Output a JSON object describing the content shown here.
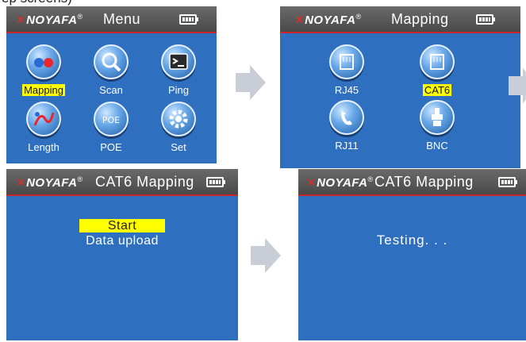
{
  "clipped_caption": "ep screens)",
  "brand": {
    "name": "NOYAFA",
    "registered": "®"
  },
  "screens": [
    {
      "title": "Menu",
      "items": [
        {
          "label": "Mapping",
          "icon": "mapping-icon",
          "selected": true
        },
        {
          "label": "Scan",
          "icon": "scan-icon",
          "selected": false
        },
        {
          "label": "Ping",
          "icon": "ping-icon",
          "selected": false
        },
        {
          "label": "Length",
          "icon": "length-icon",
          "selected": false
        },
        {
          "label": "POE",
          "icon": "poe-icon",
          "selected": false
        },
        {
          "label": "Set",
          "icon": "set-gear-icon",
          "selected": false
        }
      ]
    },
    {
      "title": "Mapping",
      "items": [
        {
          "label": "RJ45",
          "icon": "rj45-icon",
          "selected": false
        },
        {
          "label": "CAT6",
          "icon": "cat6-icon",
          "selected": true
        },
        {
          "label": "RJ11",
          "icon": "rj11-phone-icon",
          "selected": false
        },
        {
          "label": "BNC",
          "icon": "bnc-connector-icon",
          "selected": false
        }
      ]
    },
    {
      "title": "CAT6  Mapping",
      "options": [
        {
          "label": "Start",
          "selected": true
        },
        {
          "label": "Data upload",
          "selected": false
        }
      ]
    },
    {
      "title": "CAT6  Mapping",
      "status": "Testing. . ."
    }
  ],
  "colors": {
    "screen_bg": "#2f6fc0",
    "titlebar": "#5a5a5a",
    "title_rule": "#c8252b",
    "highlight": "#ffff00",
    "arrow": "#c9ced6"
  }
}
